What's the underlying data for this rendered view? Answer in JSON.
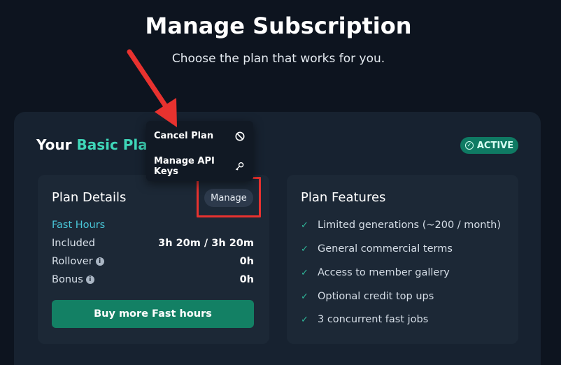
{
  "header": {
    "title": "Manage Subscription",
    "subtitle": "Choose the plan that works for you."
  },
  "plan": {
    "heading_prefix": "Your ",
    "heading_accent": "Basic Plan",
    "status_badge": "ACTIVE"
  },
  "dropdown": {
    "items": [
      {
        "label": "Cancel Plan",
        "icon": "prohibit-icon"
      },
      {
        "label": "Manage API Keys",
        "icon": "key-icon"
      }
    ]
  },
  "details": {
    "title": "Plan Details",
    "manage_label": "Manage",
    "section_label": "Fast Hours",
    "rows": [
      {
        "label": "Included",
        "value": "3h 20m / 3h 20m",
        "info": false
      },
      {
        "label": "Rollover",
        "value": "0h",
        "info": true
      },
      {
        "label": "Bonus",
        "value": "0h",
        "info": true
      }
    ],
    "buy_label": "Buy more Fast hours"
  },
  "features": {
    "title": "Plan Features",
    "items": [
      "Limited generations (~200 / month)",
      "General commercial terms",
      "Access to member gallery",
      "Optional credit top ups",
      "3 concurrent fast jobs"
    ]
  },
  "colors": {
    "accent": "#3fd7b9",
    "active_badge": "#0f7a63",
    "buy_button": "#138064",
    "highlight": "#e8322f",
    "fast_hours": "#49c6d8"
  }
}
